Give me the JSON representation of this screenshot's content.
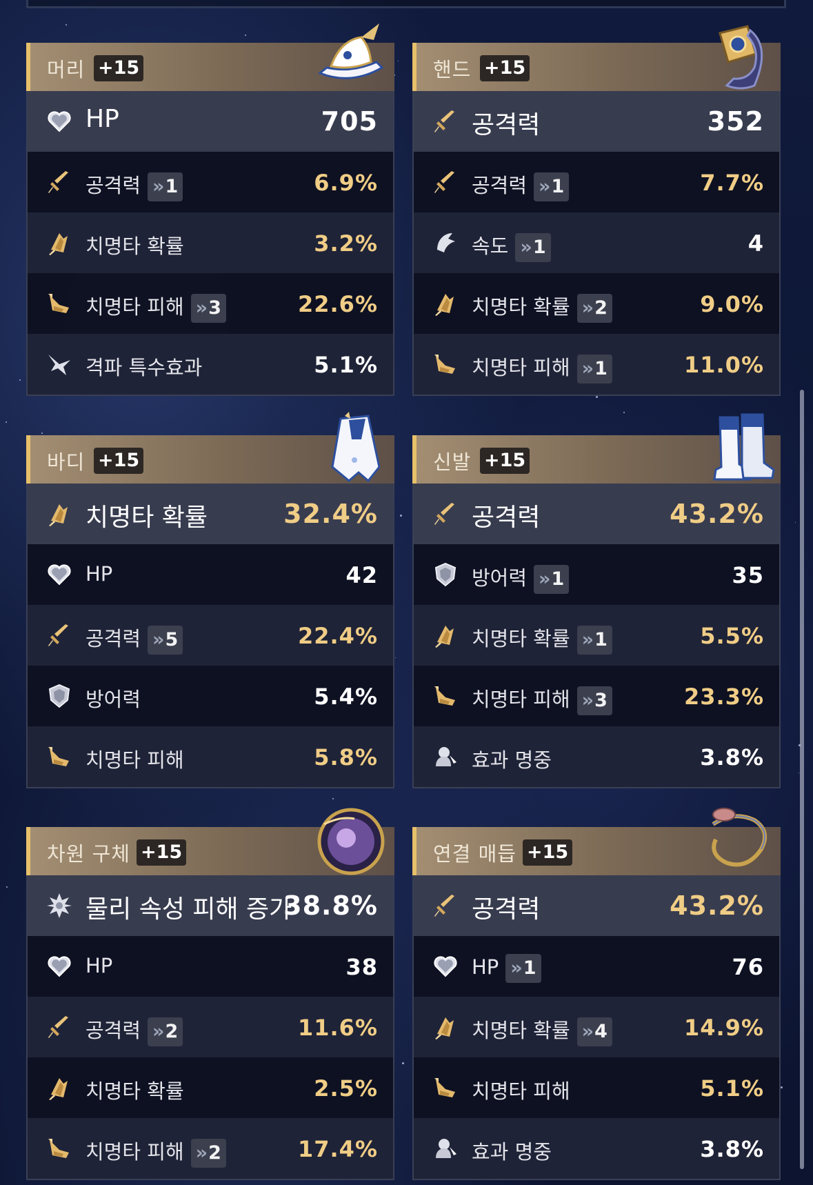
{
  "cards": [
    {
      "slot": "머리",
      "level": "+15",
      "art": "hat-icon",
      "main": {
        "icon": "heart-icon",
        "label": "HP",
        "value": "705",
        "value_color": "white"
      },
      "subs": [
        {
          "icon": "sword-icon",
          "label": "공격력",
          "roll": "1",
          "value": "6.9%",
          "value_color": "gold"
        },
        {
          "icon": "crit-rate-icon",
          "label": "치명타 확률",
          "roll": "",
          "value": "3.2%",
          "value_color": "gold"
        },
        {
          "icon": "crit-damage-icon",
          "label": "치명타 피해",
          "roll": "3",
          "value": "22.6%",
          "value_color": "gold"
        },
        {
          "icon": "break-icon",
          "label": "격파 특수효과",
          "roll": "",
          "value": "5.1%",
          "value_color": "white"
        }
      ]
    },
    {
      "slot": "핸드",
      "level": "+15",
      "art": "bracer-icon",
      "main": {
        "icon": "sword-icon",
        "label": "공격력",
        "value": "352",
        "value_color": "white"
      },
      "subs": [
        {
          "icon": "sword-icon",
          "label": "공격력",
          "roll": "1",
          "value": "7.7%",
          "value_color": "gold"
        },
        {
          "icon": "speed-icon",
          "label": "속도",
          "roll": "1",
          "value": "4",
          "value_color": "white"
        },
        {
          "icon": "crit-rate-icon",
          "label": "치명타 확률",
          "roll": "2",
          "value": "9.0%",
          "value_color": "gold"
        },
        {
          "icon": "crit-damage-icon",
          "label": "치명타 피해",
          "roll": "1",
          "value": "11.0%",
          "value_color": "gold"
        }
      ]
    },
    {
      "slot": "바디",
      "level": "+15",
      "art": "cloak-icon",
      "main": {
        "icon": "crit-rate-icon",
        "label": "치명타 확률",
        "value": "32.4%",
        "value_color": "gold"
      },
      "subs": [
        {
          "icon": "heart-icon",
          "label": "HP",
          "roll": "",
          "value": "42",
          "value_color": "white"
        },
        {
          "icon": "sword-icon",
          "label": "공격력",
          "roll": "5",
          "value": "22.4%",
          "value_color": "gold"
        },
        {
          "icon": "shield-icon",
          "label": "방어력",
          "roll": "",
          "value": "5.4%",
          "value_color": "white"
        },
        {
          "icon": "crit-damage-icon",
          "label": "치명타 피해",
          "roll": "",
          "value": "5.8%",
          "value_color": "gold"
        }
      ]
    },
    {
      "slot": "신발",
      "level": "+15",
      "art": "boots-icon",
      "main": {
        "icon": "sword-icon",
        "label": "공격력",
        "value": "43.2%",
        "value_color": "gold"
      },
      "subs": [
        {
          "icon": "shield-icon",
          "label": "방어력",
          "roll": "1",
          "value": "35",
          "value_color": "white"
        },
        {
          "icon": "crit-rate-icon",
          "label": "치명타 확률",
          "roll": "1",
          "value": "5.5%",
          "value_color": "gold"
        },
        {
          "icon": "crit-damage-icon",
          "label": "치명타 피해",
          "roll": "3",
          "value": "23.3%",
          "value_color": "gold"
        },
        {
          "icon": "effect-hit-icon",
          "label": "효과 명중",
          "roll": "",
          "value": "3.8%",
          "value_color": "white"
        }
      ]
    },
    {
      "slot": "차원 구체",
      "level": "+15",
      "art": "sphere-icon",
      "main": {
        "icon": "physical-icon",
        "label": "물리 속성 피해 증가",
        "value": "38.8%",
        "value_color": "white"
      },
      "subs": [
        {
          "icon": "heart-icon",
          "label": "HP",
          "roll": "",
          "value": "38",
          "value_color": "white"
        },
        {
          "icon": "sword-icon",
          "label": "공격력",
          "roll": "2",
          "value": "11.6%",
          "value_color": "gold"
        },
        {
          "icon": "crit-rate-icon",
          "label": "치명타 확률",
          "roll": "",
          "value": "2.5%",
          "value_color": "gold"
        },
        {
          "icon": "crit-damage-icon",
          "label": "치명타 피해",
          "roll": "2",
          "value": "17.4%",
          "value_color": "gold"
        }
      ]
    },
    {
      "slot": "연결 매듭",
      "level": "+15",
      "art": "rope-icon",
      "main": {
        "icon": "sword-icon",
        "label": "공격력",
        "value": "43.2%",
        "value_color": "gold"
      },
      "subs": [
        {
          "icon": "heart-icon",
          "label": "HP",
          "roll": "1",
          "value": "76",
          "value_color": "white"
        },
        {
          "icon": "crit-rate-icon",
          "label": "치명타 확률",
          "roll": "4",
          "value": "14.9%",
          "value_color": "gold"
        },
        {
          "icon": "crit-damage-icon",
          "label": "치명타 피해",
          "roll": "",
          "value": "5.1%",
          "value_color": "gold"
        },
        {
          "icon": "effect-hit-icon",
          "label": "효과 명중",
          "roll": "",
          "value": "3.8%",
          "value_color": "white"
        }
      ]
    }
  ]
}
